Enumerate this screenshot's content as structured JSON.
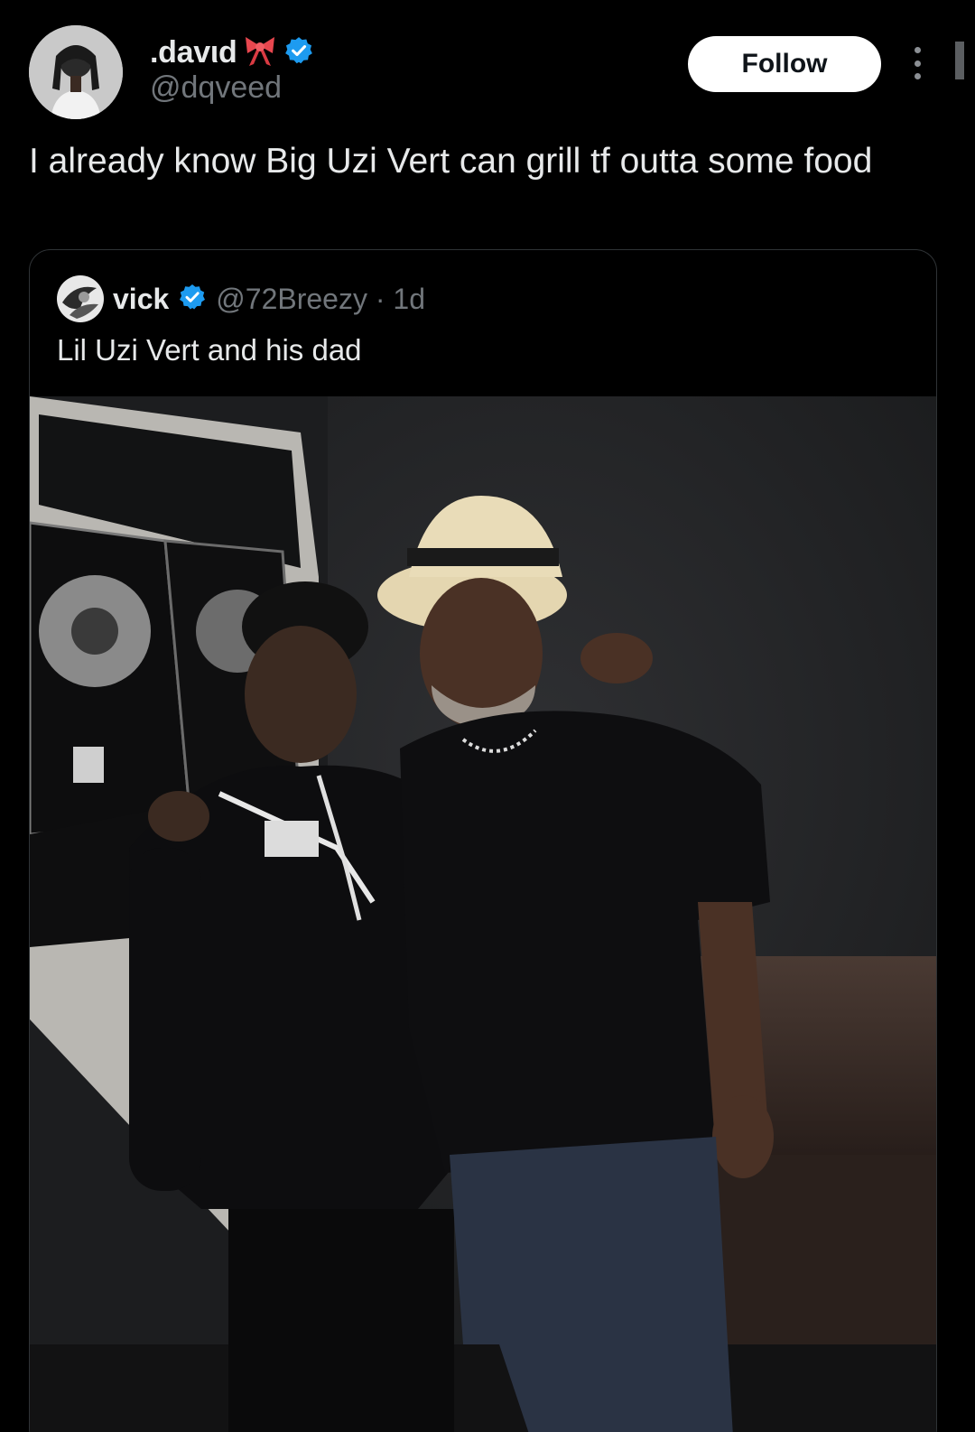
{
  "post": {
    "author": {
      "display_name": ".davιd",
      "handle": "@dqveed",
      "name_emoji": "ribbon-icon",
      "verified": true
    },
    "follow_label": "Follow",
    "text": "I already know Big Uzi Vert can grill tf outta some food"
  },
  "quoted_post": {
    "author": {
      "display_name": "vick",
      "handle": "@72Breezy",
      "verified": true
    },
    "meta": "@72Breezy · 1d",
    "text": "Lil Uzi Vert and his dad"
  },
  "colors": {
    "background": "#000000",
    "text": "#e7e9ea",
    "muted": "#71767b",
    "verified_badge": "#1d9bf0",
    "border": "#2f3336",
    "follow_button_bg": "#ffffff"
  }
}
